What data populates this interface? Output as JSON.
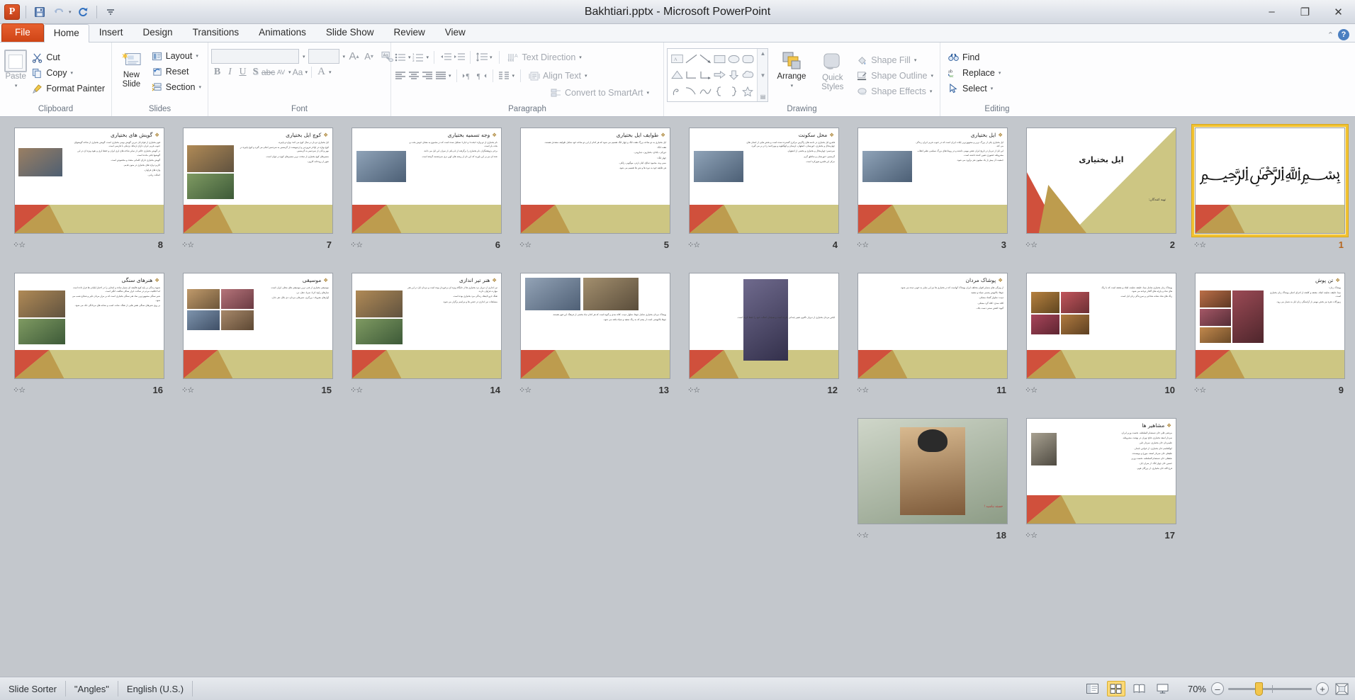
{
  "window": {
    "title": "Bakhtiari.pptx - Microsoft PowerPoint",
    "app_icon": "P",
    "minimize": "–",
    "restore": "❐",
    "close": "✕"
  },
  "quick_access": {
    "save": "save-icon",
    "undo": "undo-icon",
    "redo": "redo-icon",
    "customize": "customize-icon"
  },
  "tabs": [
    {
      "label": "File",
      "type": "file"
    },
    {
      "label": "Home",
      "type": "active"
    },
    {
      "label": "Insert",
      "type": "normal"
    },
    {
      "label": "Design",
      "type": "normal"
    },
    {
      "label": "Transitions",
      "type": "normal"
    },
    {
      "label": "Animations",
      "type": "normal"
    },
    {
      "label": "Slide Show",
      "type": "normal"
    },
    {
      "label": "Review",
      "type": "normal"
    },
    {
      "label": "View",
      "type": "normal"
    }
  ],
  "ribbon": {
    "clipboard": {
      "label": "Clipboard",
      "paste": "Paste",
      "cut": "Cut",
      "copy": "Copy",
      "format_painter": "Format Painter"
    },
    "slides": {
      "label": "Slides",
      "new_slide": "New\nSlide",
      "new_slide_l1": "New",
      "new_slide_l2": "Slide",
      "layout": "Layout",
      "reset": "Reset",
      "section": "Section"
    },
    "font": {
      "label": "Font",
      "font_name": "",
      "font_size": "",
      "grow": "A",
      "shrink": "A",
      "clear_formatting": "Aa",
      "bold": "B",
      "italic": "I",
      "underline": "U",
      "shadow": "S",
      "strikethrough": "abc",
      "spacing": "AV",
      "change_case": "Aa",
      "font_color": "A"
    },
    "paragraph": {
      "label": "Paragraph",
      "text_direction": "Text Direction",
      "align_text": "Align Text",
      "convert_to_smartart": "Convert to SmartArt"
    },
    "drawing": {
      "label": "Drawing",
      "arrange": "Arrange",
      "quick_styles_l1": "Quick",
      "quick_styles_l2": "Styles",
      "shape_fill": "Shape Fill",
      "shape_outline": "Shape Outline",
      "shape_effects": "Shape Effects"
    },
    "editing": {
      "label": "Editing",
      "find": "Find",
      "replace": "Replace",
      "select": "Select"
    }
  },
  "status": {
    "view_mode": "Slide Sorter",
    "theme": "\"Angles\"",
    "language": "English (U.S.)",
    "zoom_level": "70%",
    "zoom_out": "–",
    "zoom_in": "+",
    "fit_to_window": "fit-icon",
    "views": [
      "normal-view",
      "slide-sorter-view",
      "reading-view",
      "slide-show-view"
    ]
  },
  "slides": [
    {
      "num": "8",
      "title": "گویش های بختیاری",
      "layout": "content-left-image",
      "selected": false,
      "body": [
        "قوم بختیاری از قوام ایل دیرین گویش بومی بختیاری است. گویش بختیاری از شاخه گویشهای جنوب غربی ایران دارای ارتباط نزدیکی با فارسی است.",
        "در گویش بختیاری حالتی از سایر شاخه های لری ایران و حفظ لری و نفوذ ویژه ای در این گویشها باقی مانده است.",
        "گویش بختیاری دارای کلماتی متعدد و مخصوص است.",
        "کاربرد واژه های بختیاری در متون قدیم.",
        "واژه های فراوان.",
        "اصالت زبانی."
      ]
    },
    {
      "num": "7",
      "title": "کوچ ایل بختیاری",
      "layout": "content-two-image",
      "selected": false,
      "body": [
        "ایل بختیاری دو بار در سال کوچ می کند: بهاره و پاییزه.",
        "کوچ بهاره در اواخر فروردین و اردیبهشت از گرمسیر به سردسیر انجام می گیرد و کوچ پاییزه در مهر و آبان از سردسیر به گرمسیر.",
        "مسیرهای کوچ بختیاری از سخت ترین مسیرهای کوچ در جهان است.",
        "عبور از رودخانه کارون."
      ]
    },
    {
      "num": "6",
      "title": "وجه تسمیه بختیاری",
      "layout": "content-image-left",
      "selected": false,
      "body": [
        "نام بختیاری از دو واژه «بخت» و «یار» تشکیل شده است که در مجموع به معنای خوش بخت و بخت یار است.",
        "برخی پژوهشگران نام بختیاری را برگرفته از نام یکی از سران این ایل می دانند.",
        "عده ای نیز بر این باورند که این نام از ریشه های کهن تری سرچشمه گرفته است."
      ]
    },
    {
      "num": "5",
      "title": "طوایف ایل بختیاری",
      "layout": "content-plain",
      "selected": false,
      "body": [
        "ایل بختیاری به دو شاخه بزرگ هفت لنگ و چهار لنگ تقسیم می شود که هر کدام از این دو شاخه خود شامل طوایف متعددی هستند.",
        "هفت لنگ:",
        "دورکی، بابادی، بختیارون، دینارونی.",
        "چهار لنگ:",
        "ممی وند، محمود صالح، کیان ارثی، موگویی، زلکی.",
        "هر طایفه خود به تیره ها و تش ها تقسیم می شود."
      ]
    },
    {
      "num": "4",
      "title": "محل سکونت",
      "layout": "content-image-left",
      "selected": false,
      "body": [
        "قلمرو ایل بختیاری در دامنه های زاگرس مرکزی گسترده شده است و بخش هایی از استان های چهارمحال و بختیاری، خوزستان، اصفهان، لرستان و کهگیلویه و بویراحمد را در بر می گیرد.",
        "سردسیر: چهارمحال و بختیاری و بخشی از اصفهان.",
        "گرمسیر: خوزستان و مناطق گرم.",
        "مرکز این قلمرو شهرکرد است."
      ]
    },
    {
      "num": "3",
      "title": "ایل بختیاری",
      "layout": "content-image-left",
      "selected": false,
      "body": [
        "ایل بختیاری یکی از بزرگ ترین و مشهورترین ایلات ایران است که در جنوب غربی ایران زندگی می کند.",
        "این ایل از دیرباز در تاریخ ایران نقش مهمی داشته و در رویدادهای بزرگ سیاسی نظیر انقلاب مشروطه حضوری تعیین کننده داشته است.",
        "جمعیت آن بیش از یک میلیون نفر برآورد می شود."
      ]
    },
    {
      "num": "2",
      "title": "ایل بختیاری",
      "layout": "title-slide",
      "selected": false,
      "subtitle": "تهیه کنندگان:"
    },
    {
      "num": "1",
      "title": "بسم الله الرحمن الرحیم",
      "layout": "calligraphy",
      "selected": true
    },
    {
      "num": "16",
      "title": "هنرهای سنگی",
      "layout": "content-two-image",
      "selected": false,
      "body": [
        "شیوه زندگی بر پایه کوچ قالیچه ای بسیار ساده و ابتدایی را در اختیار ایلیاتی ها قرار داده است اما خلاقیت مردم در ساخت ابزار سنگی شگفت انگیز است.",
        "شیر سنگی مشهورترین نماد هنر سنگی بختیاری است که بر مزار مردان دلیر و شجاع نصب می شود.",
        "بر روی شیرهای سنگی نقش هایی از تفنگ، شانه، اسب و نشانه های مردانگی حک می شود."
      ]
    },
    {
      "num": "15",
      "title": "موسیقی",
      "layout": "content-grid-image",
      "selected": false,
      "body": [
        "موسیقی بختیاری از غنی ترین موسیقی های محلی ایران است.",
        "سازهای رایج: کرنا، سرنا، دهل، نی.",
        "آوازهای معروف: برزگری، شیرعلی مردان، دی بلال، هی جان."
      ]
    },
    {
      "num": "14",
      "title": "هنر تیر اندازی",
      "layout": "content-two-image",
      "selected": false,
      "body": [
        "تیر اندازی از دیرباز نزد بختیاری ها از جایگاه ویژه ای برخوردار بوده است و مردان ایل در این هنر مهارت فراوان دارند.",
        "تفنگ جزو لاینفک زندگی مرد بختیاری بوده است.",
        "مسابقات تیر اندازی در جشن ها و مراسم برگزار می شود."
      ]
    },
    {
      "num": "13",
      "title": "",
      "layout": "image-top",
      "selected": false,
      "body": [
        "پوشاک مردان بختیاری شامل چوقا، شلوار دبیت، کلاه نمدی و گیوه است که هر کدام نماد بخشی از فرهنگ این قوم هستند.",
        "چوقا بالاپوشی است از پشم که به رنگ سفید و سیاه بافته می شود."
      ]
    },
    {
      "num": "12",
      "title": "",
      "layout": "image-center",
      "selected": false,
      "body": [
        "لباس مردان بختیاری از دیرباز تاکنون تغییر چندانی نکرده است و همچنان اصالت خود را حفظ کرده است."
      ]
    },
    {
      "num": "11",
      "title": "پوشاک مردان",
      "layout": "content-plain",
      "selected": false,
      "body": [
        "از ویژگی های متمایز اقوام مختلف ایران پوشاک آنهاست که در بختیاری ها نیز این تمایز به خوبی دیده می شود.",
        "چوقا: بالاپوش پشمی سیاه و سفید.",
        "دبیت: شلوار گشاد مشکی.",
        "کلاه نمدی: کلاه گرد مشکی.",
        "گیوه: کفش سنتی دست باف."
      ]
    },
    {
      "num": "10",
      "title": "",
      "layout": "content-grid-image-2",
      "selected": false,
      "body": [
        "پوشاک زنان بختیاری شامل مینا، جلیقه، شلیته، لچک و مقنعه است که با رنگ های شاد و پارچه های گلدار دوخته می شود.",
        "رنگ های شاد نشانه شادابی و سرزندگی زنان ایل است."
      ]
    },
    {
      "num": "9",
      "title": "تن پوش",
      "layout": "content-grid-image-3",
      "selected": false,
      "body": [
        "پوشاک زنان:",
        "مینا، جلیقه، شلیته، لچک، مقنعه و کلنجه از اجزای اصلی پوشاک زنان بختیاری است.",
        "زیورآلات نقره نیز بخش مهمی از آراستگی زنان ایل به شمار می رود."
      ]
    },
    {
      "num": "18",
      "title": "",
      "layout": "photo-full",
      "selected": false,
      "subtitle": "خسته نباشید !"
    },
    {
      "num": "17",
      "title": "مشاهیر ها",
      "layout": "content-portrait",
      "selected": false,
      "body": [
        "مرتضی قلی خان صمصام السلطنه، نخست وزیر ایران.",
        "سردار اسعد بختیاری، فاتح تهران در نهضت مشروطه.",
        "علیمردان خان بختیاری، سردار دلیر.",
        "ابوالقاسم خان بختیاری، از خوانین نامدار.",
        "علیقلی خان سردار اسعد، مورخ و نویسنده.",
        "نجفقلی خان صمصام السلطنه، نخست وزیر.",
        "حسین خان چهار لنگ، از سران ایل.",
        "فرج الله خان بختیاری، از بزرگان قوم."
      ]
    }
  ]
}
